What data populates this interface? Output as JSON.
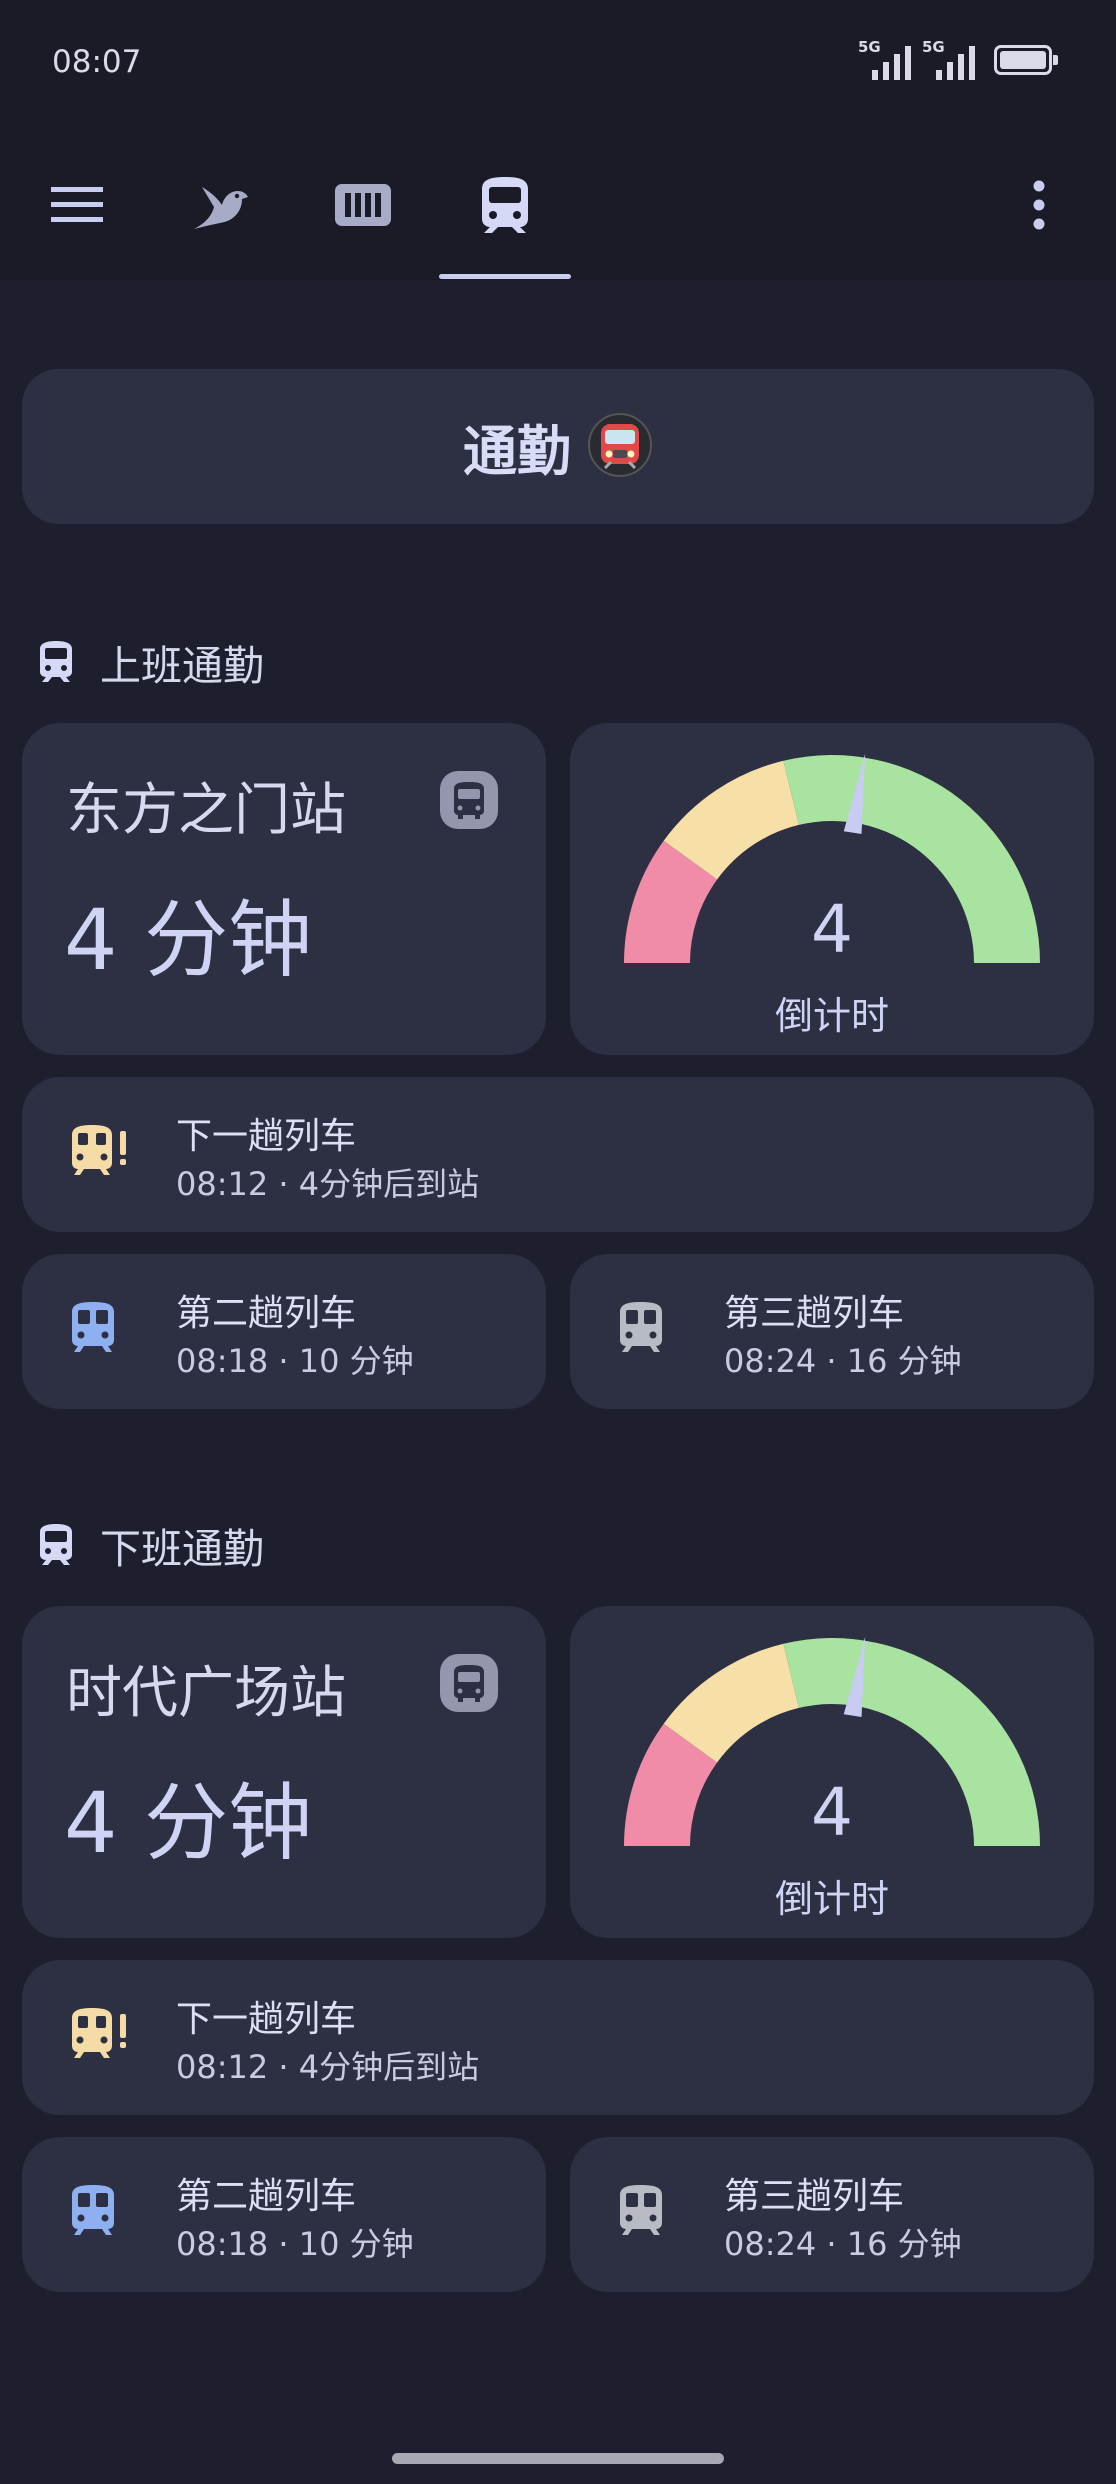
{
  "status_bar": {
    "time": "08:07",
    "signal1_label": "5G",
    "signal2_label": "5G"
  },
  "title_card": {
    "title": "通勤"
  },
  "sections": [
    {
      "heading": "上班通勤",
      "station": "东方之门站",
      "minutes": "4 分钟",
      "gauge": {
        "value": "4",
        "label": "倒计时",
        "fraction": 0.55
      },
      "next_train": {
        "title": "下一趟列车",
        "subtitle": "08:12 · 4分钟后到站"
      },
      "second_train": {
        "title": "第二趟列车",
        "subtitle": "08:18 · 10 分钟"
      },
      "third_train": {
        "title": "第三趟列车",
        "subtitle": "08:24 · 16 分钟"
      }
    },
    {
      "heading": "下班通勤",
      "station": "时代广场站",
      "minutes": "4 分钟",
      "gauge": {
        "value": "4",
        "label": "倒计时",
        "fraction": 0.55
      },
      "next_train": {
        "title": "下一趟列车",
        "subtitle": "08:12 · 4分钟后到站"
      },
      "second_train": {
        "title": "第二趟列车",
        "subtitle": "08:18 · 10 分钟"
      },
      "third_train": {
        "title": "第三趟列车",
        "subtitle": "08:24 · 16 分钟"
      }
    }
  ],
  "colors": {
    "gauge_red": "#f08ca8",
    "gauge_yellow": "#f7dfa8",
    "gauge_green": "#a8e3a0",
    "needle": "#c8ccf0",
    "icon_yellow": "#f5dba5",
    "icon_blue": "#8fb0f0",
    "icon_grey": "#b8bac4"
  },
  "icons": {
    "menu": "menu-icon",
    "bird": "bird-icon",
    "keyboard": "keyboard-icon",
    "train": "train-icon",
    "more": "more-vertical-icon"
  }
}
